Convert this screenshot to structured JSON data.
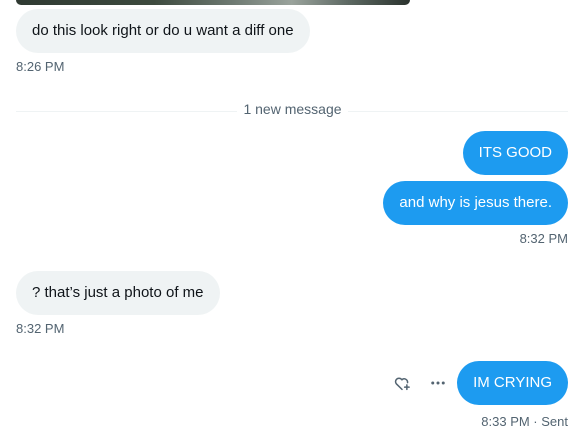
{
  "messages": [
    {
      "text": "do this look right or do u want a diff one",
      "time": "8:26 PM"
    },
    {
      "text": "ITS GOOD"
    },
    {
      "text": "and why is jesus there.",
      "time": "8:32 PM"
    },
    {
      "text": "? that’s just a photo of me",
      "time": "8:32 PM"
    },
    {
      "text": "IM CRYING",
      "time": "8:33 PM · Sent"
    }
  ],
  "divider": {
    "label": "1 new message"
  },
  "icons": {
    "react": "heart-plus-icon",
    "more": "more-horizontal-icon"
  },
  "colors": {
    "outgoing_bubble": "#1d9bf0",
    "incoming_bubble": "#eff3f4",
    "meta_text": "#536471"
  }
}
